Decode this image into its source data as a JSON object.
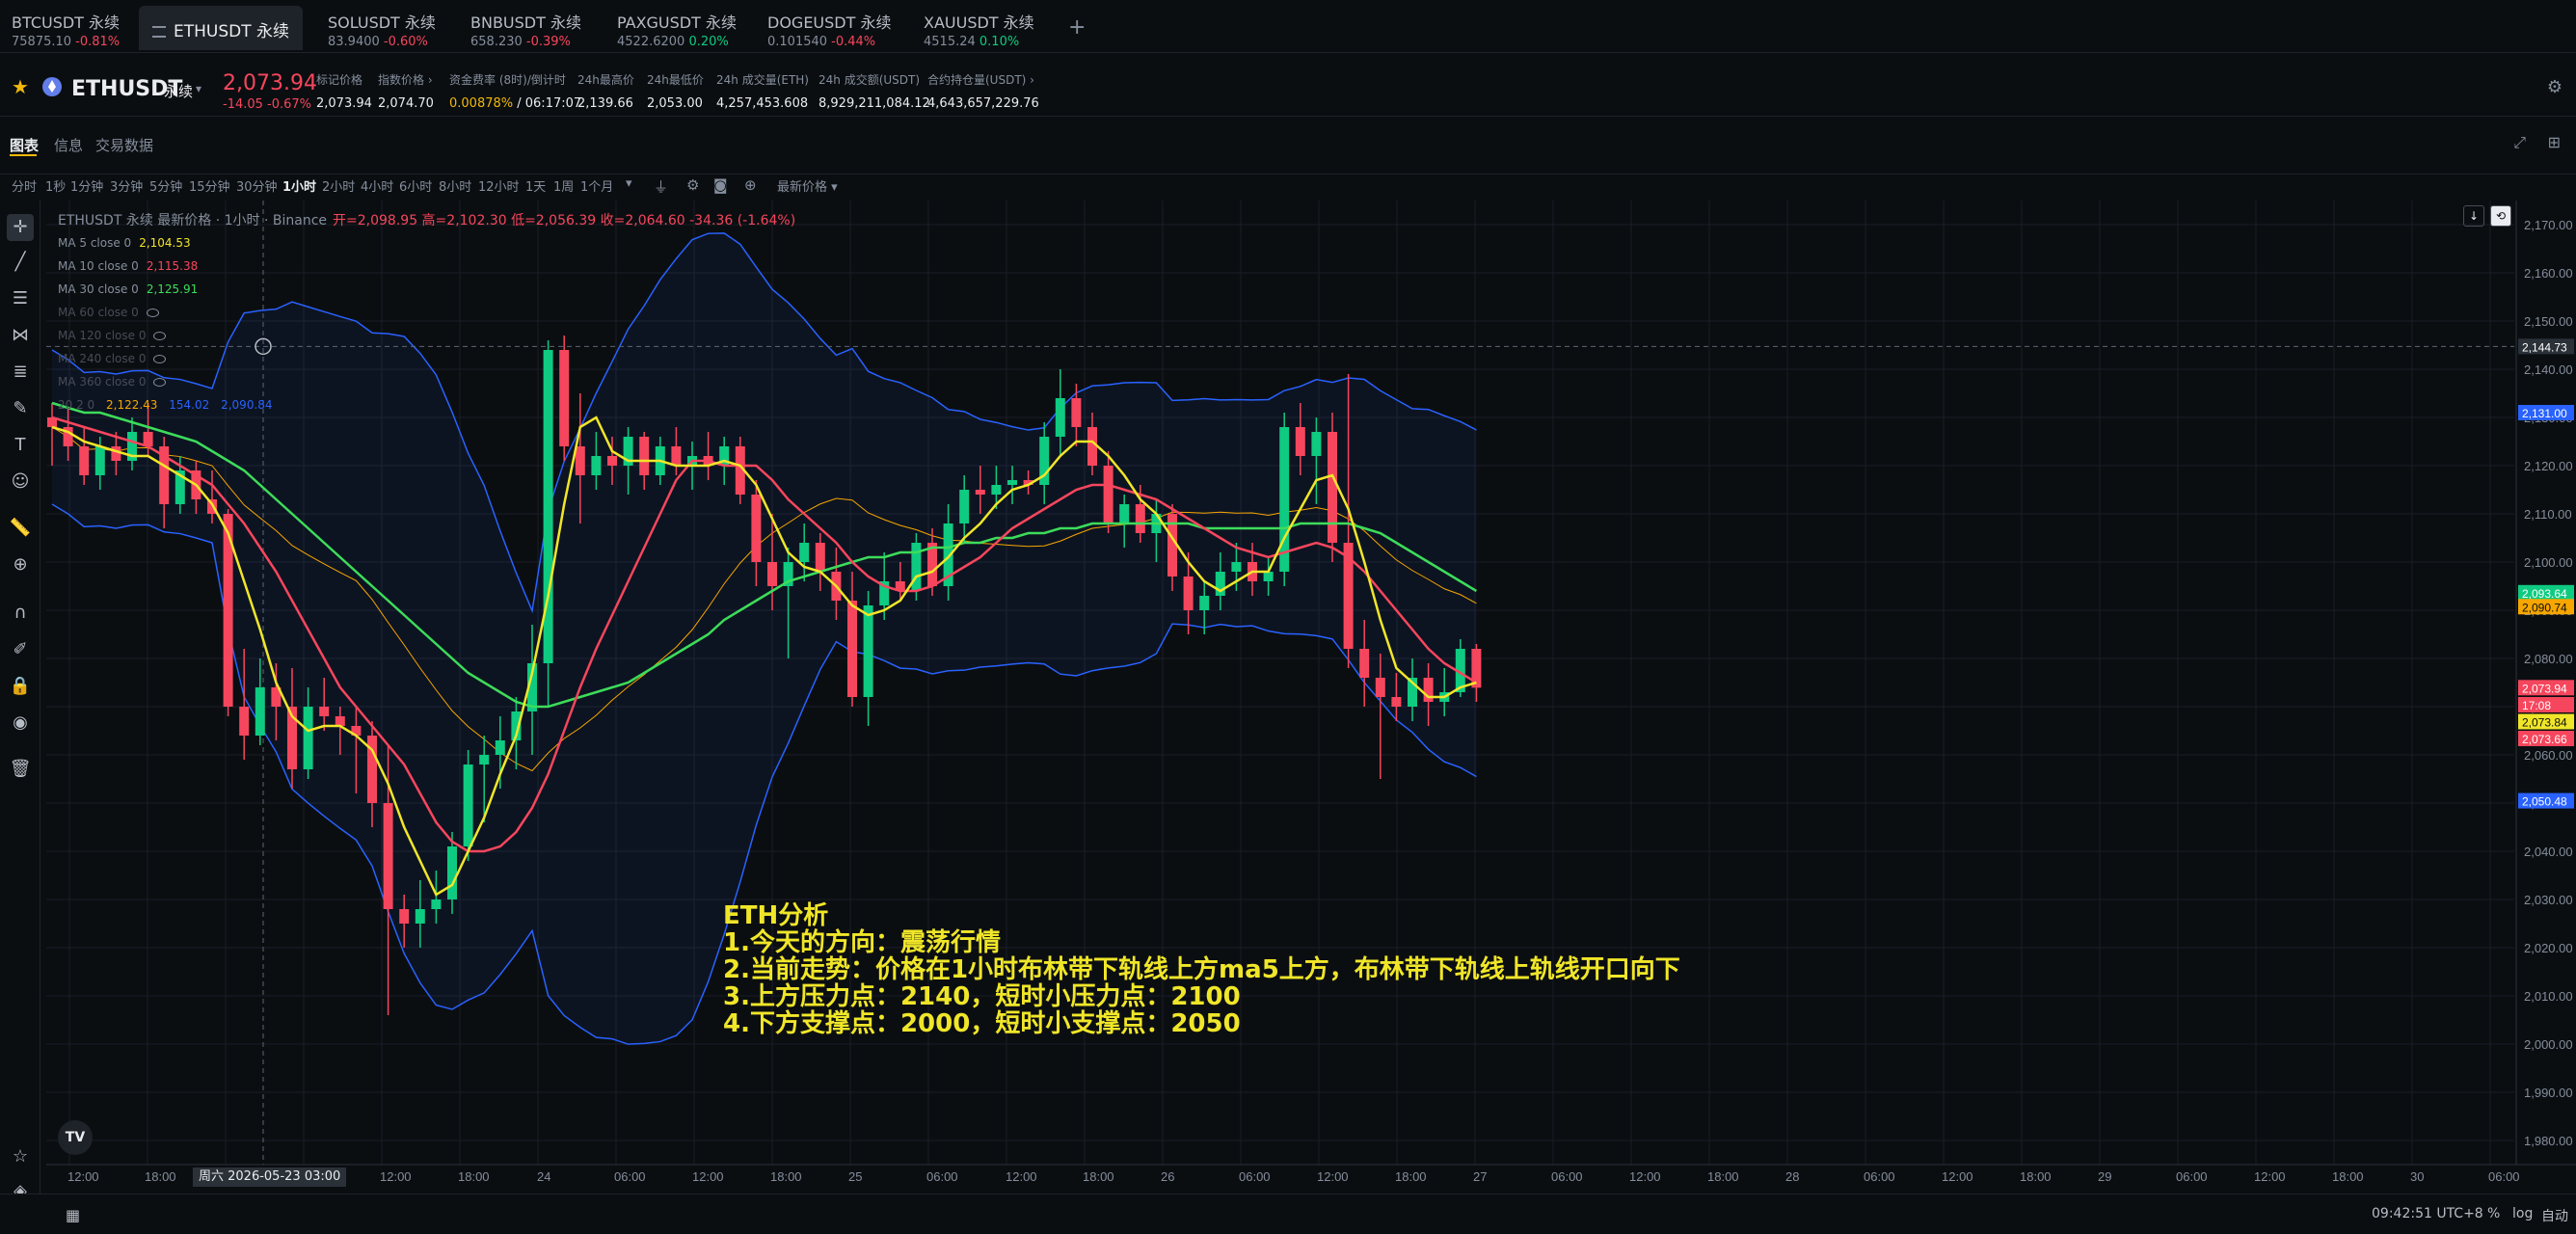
{
  "tabs": [
    {
      "name": "BTCUSDT 永续",
      "price": "75875.10",
      "change": "-0.81%",
      "dir": "neg"
    },
    {
      "name": "ETHUSDT 永续",
      "active": true
    },
    {
      "name": "SOLUSDT 永续",
      "price": "83.9400",
      "change": "-0.60%",
      "dir": "neg"
    },
    {
      "name": "BNBUSDT 永续",
      "price": "658.230",
      "change": "-0.39%",
      "dir": "neg"
    },
    {
      "name": "PAXGUSDT 永续",
      "price": "4522.6200",
      "change": "0.20%",
      "dir": "pos"
    },
    {
      "name": "DOGEUSDT 永续",
      "price": "0.101540",
      "change": "-0.44%",
      "dir": "neg"
    },
    {
      "name": "XAUUSDT 永续",
      "price": "4515.24",
      "change": "0.10%",
      "dir": "pos"
    }
  ],
  "add_tab": "+",
  "header": {
    "symbol": "ETHUSDT",
    "type": "永续",
    "caret": "▾",
    "last_price": "2,073.94",
    "change": "-14.05 -0.67%",
    "stats": [
      {
        "label": "标记价格",
        "value": "2,073.94"
      },
      {
        "label": "指数价格 ›",
        "value": "2,074.70"
      },
      {
        "label": "资金费率 (8时)/倒计时",
        "value_highlight": "0.00878%",
        "value": " / 06:17:07"
      },
      {
        "label": "24h最高价",
        "value": "2,139.66"
      },
      {
        "label": "24h最低价",
        "value": "2,053.00"
      },
      {
        "label": "24h 成交量(ETH)",
        "value": "4,257,453.608"
      },
      {
        "label": "24h 成交额(USDT)",
        "value": "8,929,211,084.12"
      },
      {
        "label": "合约持仓量(USDT) ›",
        "value": "4,643,657,229.76"
      }
    ]
  },
  "chart_tabs": [
    "图表",
    "信息",
    "交易数据"
  ],
  "intervals": [
    "分时",
    "1秒",
    "1分钟",
    "3分钟",
    "5分钟",
    "15分钟",
    "30分钟",
    "1小时",
    "2小时",
    "4小时",
    "6小时",
    "8小时",
    "12小时",
    "1天",
    "1周",
    "1个月",
    "▾"
  ],
  "active_interval": "1小时",
  "price_type": "最新价格 ▾",
  "legend": {
    "title": "ETHUSDT 永续 最新价格 · 1小时 · Binance",
    "ohlc": "开=2,098.95 高=2,102.30 低=2,056.39 收=2,064.60 -34.36 (-1.64%)",
    "ma_rows": [
      {
        "label": "MA 5 close 0",
        "value": "2,104.53",
        "color": "#f0e629"
      },
      {
        "label": "MA 10 close 0",
        "value": "2,115.38",
        "color": "#f6465d"
      },
      {
        "label": "MA 30 close 0",
        "value": "2,125.91",
        "color": "#3ddc5a"
      },
      {
        "label": "MA 60 close 0",
        "dim": true
      },
      {
        "label": "MA 120 close 0",
        "dim": true
      },
      {
        "label": "MA 240 close 0",
        "dim": true
      },
      {
        "label": "MA 360 close 0",
        "dim": true
      }
    ],
    "boll_row": {
      "label": "20 2 0",
      "v1": "2,122.43",
      "v2": "154.02",
      "v3": "2,090.84"
    }
  },
  "annotation": [
    "ETH分析",
    "1.今天的方向：震荡行情",
    "2.当前走势：价格在1小时布林带下轨线上方ma5上方，布林带下轨线上轨线开口向下",
    "3.上方压力点：2140，短时小压力点：2100",
    "4.下方支撑点：2000，短时小支撑点：2050"
  ],
  "price_axis": [
    "2,170.00",
    "2,160.00",
    "2,150.00",
    "2,140.00",
    "2,130.00",
    "2,120.00",
    "2,110.00",
    "2,100.00",
    "2,090.00",
    "2,080.00",
    "2,070.00",
    "2,060.00",
    "2,050.00",
    "2,040.00",
    "2,030.00",
    "2,020.00",
    "2,010.00",
    "2,000.00",
    "1,990.00",
    "1,980.00"
  ],
  "price_tags": [
    {
      "label": "2,144.73",
      "color": "#2b3139",
      "price": 2144.73
    },
    {
      "label": "2,131.00",
      "color": "#2962ff",
      "price": 2131.0
    },
    {
      "label": "2,093.64",
      "color": "#0ecb81",
      "price": 2093.64
    },
    {
      "label": "2,090.74",
      "color": "#f7a600",
      "price": 2090.74
    },
    {
      "label": "2,073.94",
      "color": "#f6465d",
      "price": 2073.94
    },
    {
      "label": "17:08",
      "color": "#f6465d",
      "price": 2070.4
    },
    {
      "label": "2,073.84",
      "color": "#f0e629",
      "price": 2066.9
    },
    {
      "label": "2,073.66",
      "color": "#f6465d",
      "price": 2063.4
    },
    {
      "label": "2,050.48",
      "color": "#2962ff",
      "price": 2050.48
    }
  ],
  "time_axis": [
    "12:00",
    "18:00",
    "周六 2026-05-23",
    "03:00",
    "12:00",
    "18:00",
    "24",
    "06:00",
    "12:00",
    "18:00",
    "25",
    "06:00",
    "12:00",
    "18:00",
    "26",
    "06:00",
    "12:00",
    "18:00",
    "27",
    "06:00",
    "12:00",
    "18:00",
    "28",
    "06:00",
    "12:00",
    "18:00",
    "29",
    "06:00",
    "12:00",
    "18:00",
    "30",
    "06:00"
  ],
  "cursor_date": "周六 2026-05-23   03:00",
  "bottom": {
    "time": "09:42:51 UTC+8",
    "pct": "%",
    "log": "log",
    "auto": "自动"
  },
  "tv_logo": "TV",
  "chart_data": {
    "type": "candlestick",
    "interval": "1小时",
    "ylim": [
      1975,
      2175
    ],
    "candles": [
      [
        2130,
        2133,
        2120,
        2128
      ],
      [
        2128,
        2132,
        2121,
        2124
      ],
      [
        2124,
        2128,
        2116,
        2118
      ],
      [
        2118,
        2126,
        2115,
        2124
      ],
      [
        2124,
        2127,
        2118,
        2121
      ],
      [
        2121,
        2130,
        2119,
        2127
      ],
      [
        2127,
        2133,
        2122,
        2124
      ],
      [
        2124,
        2126,
        2107,
        2112
      ],
      [
        2112,
        2122,
        2110,
        2119
      ],
      [
        2119,
        2121,
        2110,
        2113
      ],
      [
        2113,
        2119,
        2108,
        2110
      ],
      [
        2110,
        2111,
        2068,
        2070
      ],
      [
        2070,
        2082,
        2059,
        2064
      ],
      [
        2064,
        2080,
        2062,
        2074
      ],
      [
        2074,
        2079,
        2063,
        2070
      ],
      [
        2070,
        2078,
        2053,
        2057
      ],
      [
        2057,
        2074,
        2055,
        2070
      ],
      [
        2070,
        2076,
        2065,
        2068
      ],
      [
        2068,
        2070,
        2060,
        2066
      ],
      [
        2066,
        2070,
        2052,
        2064
      ],
      [
        2064,
        2067,
        2045,
        2050
      ],
      [
        2050,
        2062,
        2006,
        2028
      ],
      [
        2028,
        2031,
        2020,
        2025
      ],
      [
        2025,
        2034,
        2020,
        2028
      ],
      [
        2028,
        2036,
        2025,
        2030
      ],
      [
        2030,
        2044,
        2027,
        2041
      ],
      [
        2041,
        2061,
        2038,
        2058
      ],
      [
        2058,
        2064,
        2046,
        2060
      ],
      [
        2060,
        2068,
        2053,
        2063
      ],
      [
        2063,
        2072,
        2057,
        2069
      ],
      [
        2069,
        2087,
        2060,
        2079
      ],
      [
        2079,
        2146,
        2070,
        2144
      ],
      [
        2144,
        2147,
        2121,
        2124
      ],
      [
        2124,
        2135,
        2108,
        2118
      ],
      [
        2118,
        2127,
        2115,
        2122
      ],
      [
        2122,
        2126,
        2116,
        2120
      ],
      [
        2120,
        2128,
        2114,
        2126
      ],
      [
        2126,
        2127,
        2115,
        2118
      ],
      [
        2118,
        2126,
        2116,
        2124
      ],
      [
        2124,
        2128,
        2118,
        2120
      ],
      [
        2120,
        2125,
        2115,
        2122
      ],
      [
        2122,
        2127,
        2117,
        2120
      ],
      [
        2120,
        2126,
        2116,
        2124
      ],
      [
        2124,
        2126,
        2112,
        2114
      ],
      [
        2114,
        2117,
        2095,
        2100
      ],
      [
        2100,
        2110,
        2090,
        2095
      ],
      [
        2095,
        2103,
        2080,
        2100
      ],
      [
        2100,
        2108,
        2096,
        2104
      ],
      [
        2104,
        2106,
        2094,
        2098
      ],
      [
        2098,
        2103,
        2088,
        2092
      ],
      [
        2092,
        2098,
        2070,
        2072
      ],
      [
        2072,
        2094,
        2066,
        2091
      ],
      [
        2091,
        2102,
        2088,
        2096
      ],
      [
        2096,
        2100,
        2092,
        2094
      ],
      [
        2094,
        2106,
        2092,
        2104
      ],
      [
        2104,
        2107,
        2093,
        2095
      ],
      [
        2095,
        2112,
        2092,
        2108
      ],
      [
        2108,
        2118,
        2104,
        2115
      ],
      [
        2115,
        2120,
        2110,
        2114
      ],
      [
        2114,
        2120,
        2111,
        2116
      ],
      [
        2116,
        2120,
        2112,
        2117
      ],
      [
        2117,
        2119,
        2114,
        2116
      ],
      [
        2116,
        2129,
        2112,
        2126
      ],
      [
        2126,
        2140,
        2122,
        2134
      ],
      [
        2134,
        2137,
        2124,
        2128
      ],
      [
        2128,
        2131,
        2118,
        2120
      ],
      [
        2120,
        2123,
        2106,
        2108
      ],
      [
        2108,
        2114,
        2103,
        2112
      ],
      [
        2112,
        2116,
        2104,
        2106
      ],
      [
        2106,
        2113,
        2100,
        2110
      ],
      [
        2110,
        2112,
        2094,
        2097
      ],
      [
        2097,
        2102,
        2085,
        2090
      ],
      [
        2090,
        2096,
        2085,
        2093
      ],
      [
        2093,
        2102,
        2090,
        2098
      ],
      [
        2098,
        2104,
        2094,
        2100
      ],
      [
        2100,
        2104,
        2093,
        2096
      ],
      [
        2096,
        2101,
        2093,
        2098
      ],
      [
        2098,
        2131,
        2095,
        2128
      ],
      [
        2128,
        2133,
        2118,
        2122
      ],
      [
        2122,
        2130,
        2112,
        2127
      ],
      [
        2127,
        2131,
        2100,
        2104
      ],
      [
        2104,
        2139,
        2078,
        2082
      ],
      [
        2082,
        2088,
        2070,
        2076
      ],
      [
        2076,
        2081,
        2055,
        2072
      ],
      [
        2072,
        2077,
        2067,
        2070
      ],
      [
        2070,
        2080,
        2067,
        2076
      ],
      [
        2076,
        2079,
        2066,
        2071
      ],
      [
        2071,
        2078,
        2068,
        2073
      ],
      [
        2073,
        2084,
        2072,
        2082
      ],
      [
        2082,
        2083,
        2071,
        2073.94
      ]
    ],
    "ma5": [
      2128,
      2127,
      2125,
      2124,
      2123,
      2122,
      2122,
      2120,
      2118,
      2116,
      2112,
      2106,
      2096,
      2086,
      2075,
      2068,
      2065,
      2066,
      2066,
      2064,
      2061,
      2054,
      2045,
      2038,
      2031,
      2033,
      2040,
      2047,
      2056,
      2064,
      2077,
      2093,
      2112,
      2128,
      2130,
      2123,
      2121,
      2121,
      2121,
      2120,
      2120,
      2120,
      2121,
      2120,
      2116,
      2109,
      2102,
      2099,
      2098,
      2095,
      2091,
      2089,
      2090,
      2092,
      2097,
      2098,
      2101,
      2105,
      2108,
      2112,
      2115,
      2116,
      2118,
      2122,
      2125,
      2125,
      2122,
      2118,
      2113,
      2110,
      2105,
      2100,
      2096,
      2094,
      2096,
      2098,
      2098,
      2105,
      2111,
      2117,
      2118,
      2111,
      2100,
      2088,
      2078,
      2075,
      2072,
      2072,
      2074,
      2075
    ],
    "ma10": [
      2130,
      2129,
      2128,
      2127,
      2126,
      2125,
      2124,
      2122,
      2120,
      2118,
      2116,
      2112,
      2108,
      2103,
      2098,
      2092,
      2086,
      2080,
      2074,
      2070,
      2066,
      2062,
      2058,
      2052,
      2046,
      2042,
      2040,
      2040,
      2041,
      2044,
      2049,
      2056,
      2065,
      2074,
      2082,
      2089,
      2096,
      2103,
      2110,
      2117,
      2121,
      2121,
      2120,
      2120,
      2120,
      2117,
      2113,
      2110,
      2107,
      2104,
      2100,
      2097,
      2095,
      2094,
      2094,
      2095,
      2097,
      2099,
      2101,
      2104,
      2107,
      2109,
      2111,
      2113,
      2115,
      2116,
      2116,
      2115,
      2114,
      2113,
      2111,
      2109,
      2107,
      2105,
      2103,
      2102,
      2101,
      2102,
      2103,
      2104,
      2103,
      2101,
      2098,
      2094,
      2090,
      2086,
      2082,
      2079,
      2077,
      2075
    ],
    "ma30": [
      2133,
      2132,
      2131,
      2131,
      2130,
      2129,
      2128,
      2127,
      2126,
      2125,
      2123,
      2121,
      2119,
      2116,
      2113,
      2110,
      2107,
      2104,
      2101,
      2098,
      2095,
      2092,
      2089,
      2086,
      2083,
      2080,
      2077,
      2075,
      2073,
      2071,
      2070,
      2070,
      2071,
      2072,
      2073,
      2074,
      2075,
      2077,
      2079,
      2081,
      2083,
      2085,
      2088,
      2090,
      2092,
      2094,
      2096,
      2097,
      2098,
      2099,
      2100,
      2101,
      2101,
      2102,
      2102,
      2103,
      2103,
      2104,
      2104,
      2105,
      2105,
      2106,
      2106,
      2107,
      2107,
      2108,
      2108,
      2108,
      2108,
      2108,
      2108,
      2108,
      2107,
      2107,
      2107,
      2107,
      2107,
      2107,
      2108,
      2108,
      2108,
      2108,
      2107,
      2106,
      2104,
      2102,
      2100,
      2098,
      2096,
      2094
    ]
  }
}
